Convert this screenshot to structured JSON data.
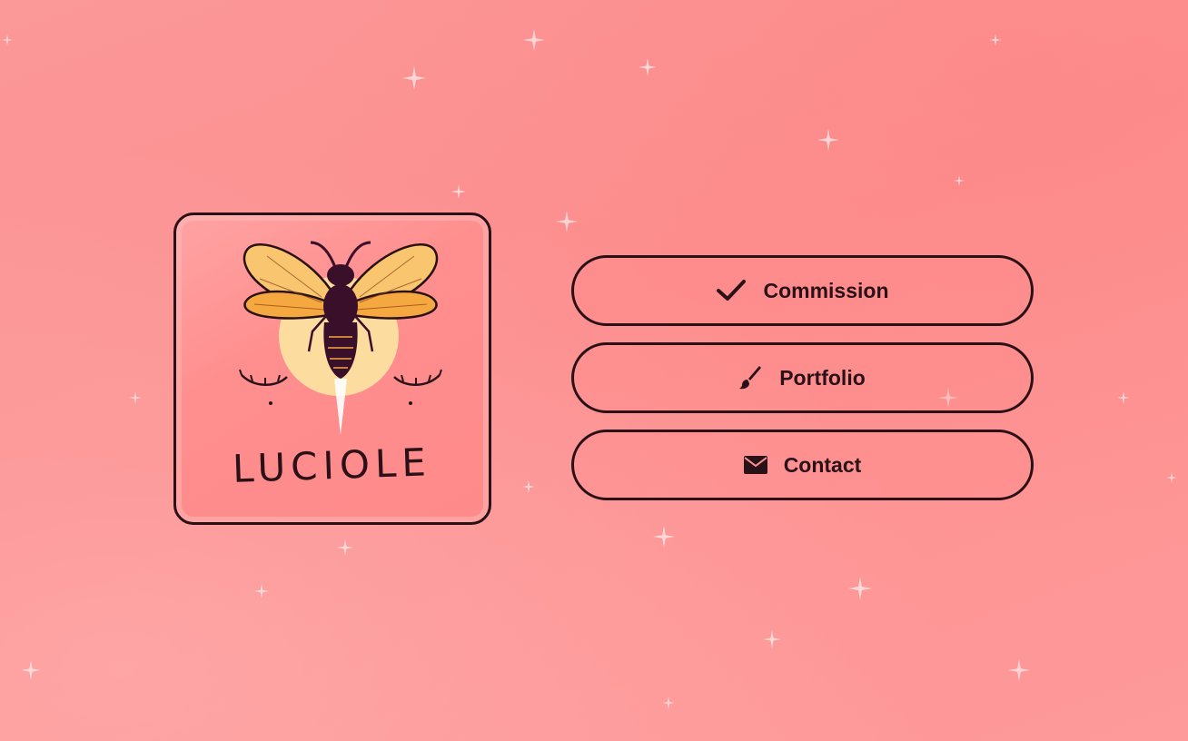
{
  "brand": {
    "logo_text": "LUCIOLE"
  },
  "nav": {
    "buttons": [
      {
        "label": "Commission",
        "icon": "check-icon"
      },
      {
        "label": "Portfolio",
        "icon": "paintbrush-icon"
      },
      {
        "label": "Contact",
        "icon": "envelope-icon"
      }
    ]
  },
  "colors": {
    "background": "#fd9292",
    "outline": "#2a1118",
    "wing": "#f5a83f",
    "body": "#3a0f2a",
    "sun": "#fddca0"
  }
}
